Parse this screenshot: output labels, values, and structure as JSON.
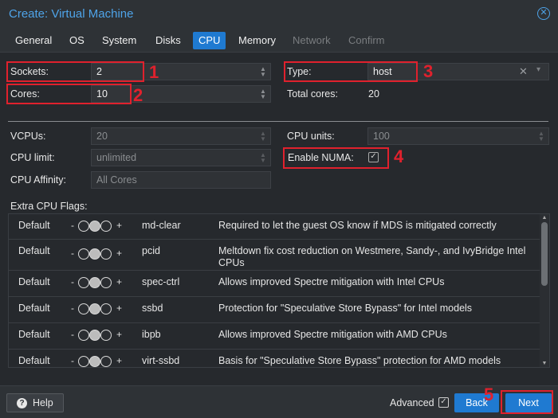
{
  "window": {
    "title": "Create: Virtual Machine"
  },
  "tabs": [
    {
      "label": "General"
    },
    {
      "label": "OS"
    },
    {
      "label": "System"
    },
    {
      "label": "Disks"
    },
    {
      "label": "CPU"
    },
    {
      "label": "Memory"
    },
    {
      "label": "Network"
    },
    {
      "label": "Confirm"
    }
  ],
  "cpu": {
    "sockets_label": "Sockets:",
    "sockets_value": "2",
    "cores_label": "Cores:",
    "cores_value": "10",
    "type_label": "Type:",
    "type_value": "host",
    "type_clear": "✕",
    "total_cores_label": "Total cores:",
    "total_cores_value": "20",
    "vcpus_label": "VCPUs:",
    "vcpus_value": "20",
    "cpu_limit_label": "CPU limit:",
    "cpu_limit_value": "unlimited",
    "cpu_affinity_label": "CPU Affinity:",
    "cpu_affinity_value": "All Cores",
    "cpu_units_label": "CPU units:",
    "cpu_units_value": "100",
    "numa_label": "Enable NUMA:",
    "numa_checked": true,
    "extra_flags_label": "Extra CPU Flags:"
  },
  "annotations": [
    "1",
    "2",
    "3",
    "4",
    "5"
  ],
  "flag_sign_minus": "-",
  "flag_sign_plus": "+",
  "flags": [
    {
      "state": "Default",
      "name": "md-clear",
      "desc": "Required to let the guest OS know if MDS is mitigated correctly"
    },
    {
      "state": "Default",
      "name": "pcid",
      "desc": "Meltdown fix cost reduction on Westmere, Sandy-, and IvyBridge Intel CPUs"
    },
    {
      "state": "Default",
      "name": "spec-ctrl",
      "desc": "Allows improved Spectre mitigation with Intel CPUs"
    },
    {
      "state": "Default",
      "name": "ssbd",
      "desc": "Protection for \"Speculative Store Bypass\" for Intel models"
    },
    {
      "state": "Default",
      "name": "ibpb",
      "desc": "Allows improved Spectre mitigation with AMD CPUs"
    },
    {
      "state": "Default",
      "name": "virt-ssbd",
      "desc": "Basis for \"Speculative Store Bypass\" protection for AMD models"
    }
  ],
  "footer": {
    "help_label": "Help",
    "advanced_label": "Advanced",
    "back_label": "Back",
    "next_label": "Next"
  },
  "colors": {
    "accent": "#1f7ad1",
    "title": "#4ea3e8",
    "highlight": "#e0212d"
  }
}
